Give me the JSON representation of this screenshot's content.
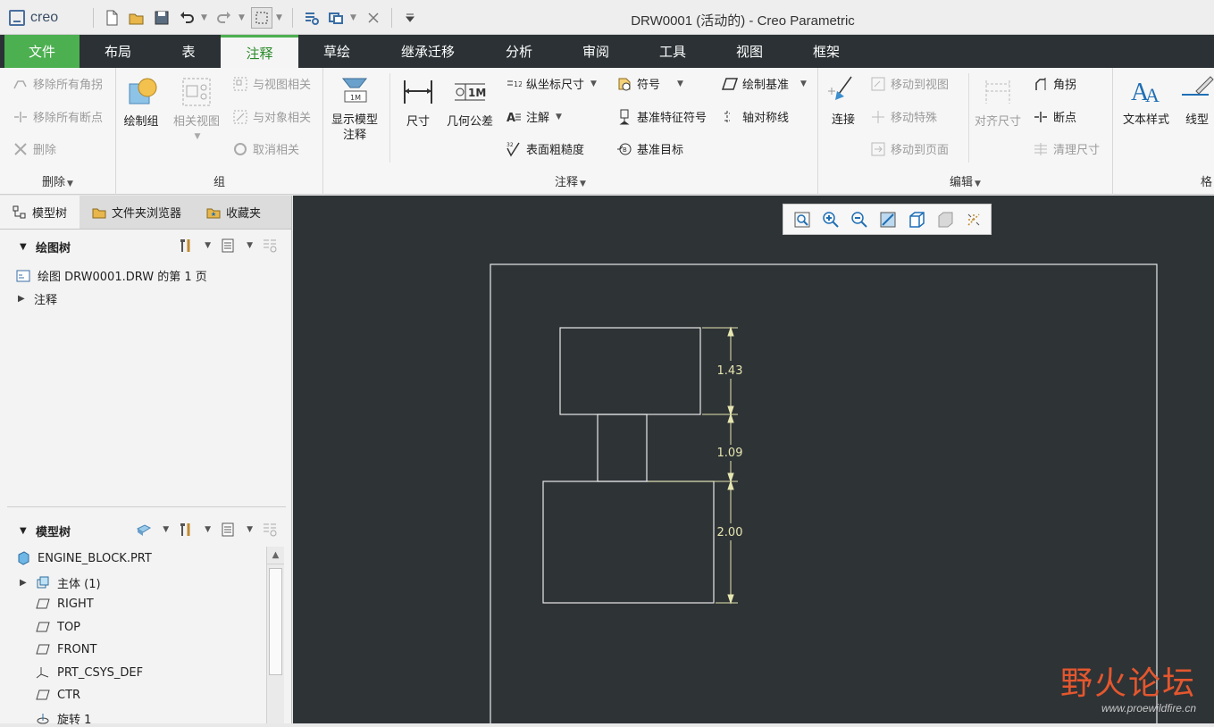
{
  "app": {
    "logo_text": "creo",
    "window_title": "DRW0001 (活动的) - Creo Parametric"
  },
  "quick_access": [
    "new-icon",
    "open-icon",
    "save-icon",
    "undo-icon",
    "redo-icon",
    "select-box-icon",
    "regenerate-icon",
    "window-icon",
    "close-window-icon",
    "customize-icon"
  ],
  "tabs": [
    {
      "label": "文件"
    },
    {
      "label": "布局"
    },
    {
      "label": "表"
    },
    {
      "label": "注释"
    },
    {
      "label": "草绘"
    },
    {
      "label": "继承迁移"
    },
    {
      "label": "分析"
    },
    {
      "label": "审阅"
    },
    {
      "label": "工具"
    },
    {
      "label": "视图"
    },
    {
      "label": "框架"
    }
  ],
  "ribbon": {
    "delete_group": {
      "label": "删除",
      "items": [
        "移除所有角拐",
        "移除所有断点",
        "删除"
      ]
    },
    "group_group": {
      "label": "组",
      "draw_group": "绘制组",
      "related_view": "相关视图",
      "items": [
        "与视图相关",
        "与对象相关",
        "取消相关"
      ]
    },
    "annotation_group": {
      "label": "注释",
      "show_model_annotation": "显示模型\n注释",
      "dimension": "尺寸",
      "gtol": "几何公差",
      "ordinate": "纵坐标尺寸",
      "note": "注解",
      "surface_finish": "表面粗糙度",
      "symbol": "符号",
      "datum_feature": "基准特征符号",
      "datum_target": "基准目标",
      "draw_datum": "绘制基准",
      "axis_symmetry": "轴对称线"
    },
    "edit_group": {
      "label": "编辑",
      "connect": "连接",
      "move_to_view": "移动到视图",
      "move_special": "移动特殊",
      "move_to_page": "移动到页面",
      "align_dimension": "对齐尺寸",
      "jog": "角拐",
      "breakpoint": "断点",
      "cleanup_dimension": "清理尺寸"
    },
    "format_group": {
      "text_style": "文本样式",
      "line_style": "线型",
      "label": "格"
    }
  },
  "left_panel": {
    "tabs": [
      "模型树",
      "文件夹浏览器",
      "收藏夹"
    ],
    "drawing_tree": {
      "title": "绘图树",
      "nodes": [
        "绘图 DRW0001.DRW 的第 1 页",
        "注释"
      ]
    },
    "model_tree": {
      "title": "模型树",
      "nodes": [
        "ENGINE_BLOCK.PRT",
        "主体 (1)",
        "RIGHT",
        "TOP",
        "FRONT",
        "PRT_CSYS_DEF",
        "CTR",
        "旋转 1"
      ]
    }
  },
  "view_toolbar": [
    "refit-icon",
    "zoom-in-icon",
    "zoom-out-icon",
    "repaint-icon",
    "display-style-icon",
    "shading-icon",
    "datum-display-icon"
  ],
  "drawing": {
    "dimensions": [
      "1.43",
      "1.09",
      "2.00"
    ]
  },
  "watermark": {
    "main": "野火论坛",
    "url": "www.proewildfire.cn"
  },
  "colors": {
    "file_tab": "#4caf50",
    "canvas_bg": "#2e3336",
    "dimension": "#e6e6b0",
    "active_tab_text": "#2a8a2a"
  }
}
